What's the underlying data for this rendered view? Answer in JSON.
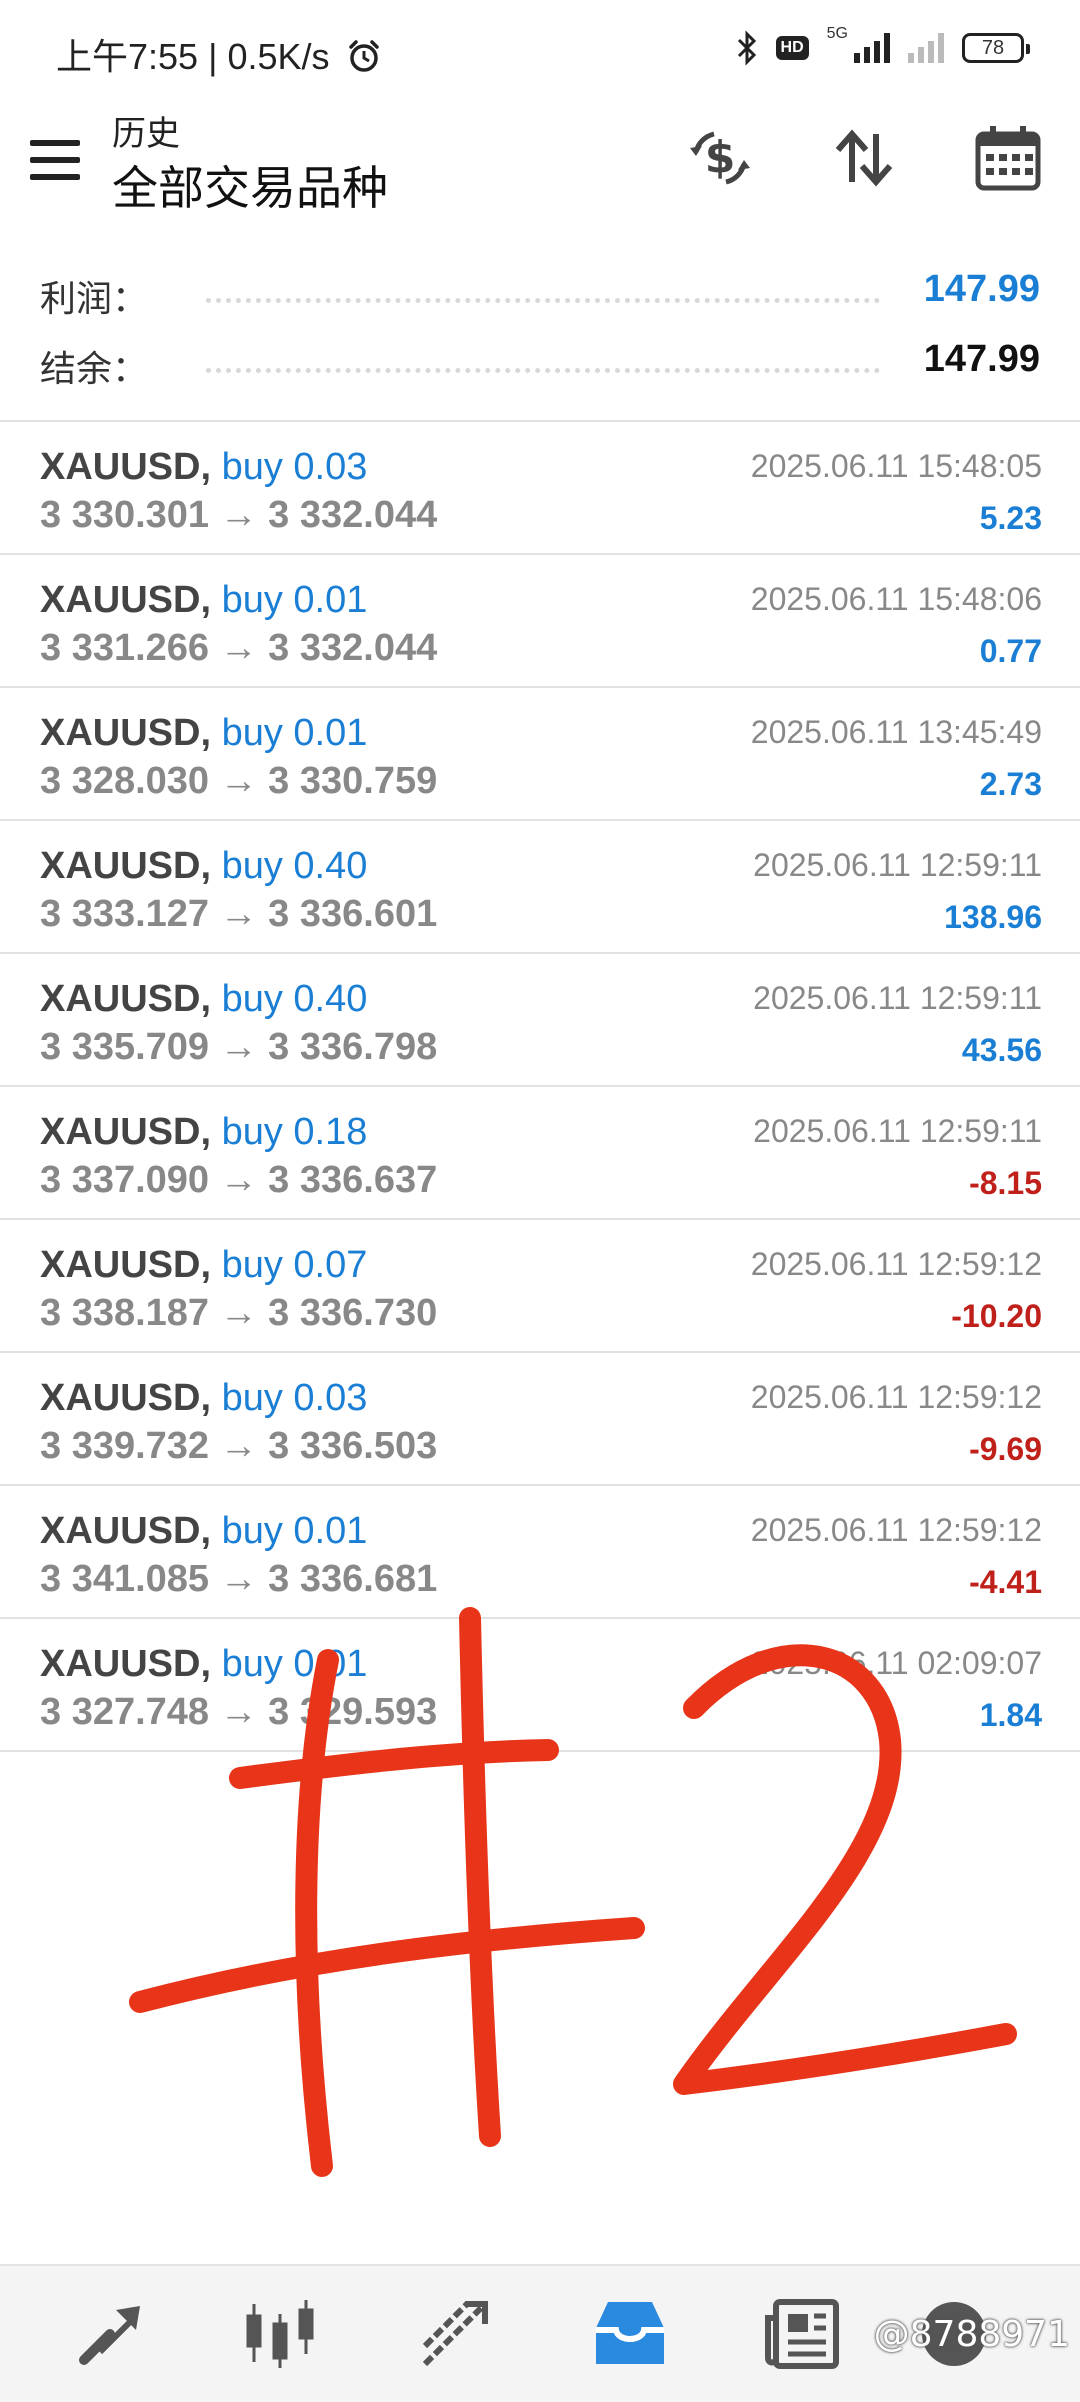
{
  "status_bar": {
    "time": "上午7:55",
    "net_speed": "0.5K/s",
    "hd": "HD",
    "network": "5G",
    "battery": "78"
  },
  "header": {
    "subtitle": "历史",
    "title": "全部交易品种"
  },
  "summary": {
    "profit_label": "利润：",
    "profit_value": "147.99",
    "balance_label": "结余：",
    "balance_value": "147.99"
  },
  "colors": {
    "positive": "#1a7fd4",
    "negative": "#c0201a",
    "overlay_mark": "#e8351a"
  },
  "trades": [
    {
      "symbol": "XAUUSD,",
      "side": "buy 0.03",
      "prices": "3 330.301 → 3 332.044",
      "time": "2025.06.11 15:48:05",
      "profit": "5.23",
      "sign": "pos"
    },
    {
      "symbol": "XAUUSD,",
      "side": "buy 0.01",
      "prices": "3 331.266 → 3 332.044",
      "time": "2025.06.11 15:48:06",
      "profit": "0.77",
      "sign": "pos"
    },
    {
      "symbol": "XAUUSD,",
      "side": "buy 0.01",
      "prices": "3 328.030 → 3 330.759",
      "time": "2025.06.11 13:45:49",
      "profit": "2.73",
      "sign": "pos"
    },
    {
      "symbol": "XAUUSD,",
      "side": "buy 0.40",
      "prices": "3 333.127 → 3 336.601",
      "time": "2025.06.11 12:59:11",
      "profit": "138.96",
      "sign": "pos"
    },
    {
      "symbol": "XAUUSD,",
      "side": "buy 0.40",
      "prices": "3 335.709 → 3 336.798",
      "time": "2025.06.11 12:59:11",
      "profit": "43.56",
      "sign": "pos"
    },
    {
      "symbol": "XAUUSD,",
      "side": "buy 0.18",
      "prices": "3 337.090 → 3 336.637",
      "time": "2025.06.11 12:59:11",
      "profit": "-8.15",
      "sign": "neg"
    },
    {
      "symbol": "XAUUSD,",
      "side": "buy 0.07",
      "prices": "3 338.187 → 3 336.730",
      "time": "2025.06.11 12:59:12",
      "profit": "-10.20",
      "sign": "neg"
    },
    {
      "symbol": "XAUUSD,",
      "side": "buy 0.03",
      "prices": "3 339.732 → 3 336.503",
      "time": "2025.06.11 12:59:12",
      "profit": "-9.69",
      "sign": "neg"
    },
    {
      "symbol": "XAUUSD,",
      "side": "buy 0.01",
      "prices": "3 341.085 → 3 336.681",
      "time": "2025.06.11 12:59:12",
      "profit": "-4.41",
      "sign": "neg"
    },
    {
      "symbol": "XAUUSD,",
      "side": "buy 0.01",
      "prices": "3 327.748 → 3 329.593",
      "time": "2025.06.11 02:09:07",
      "profit": "1.84",
      "sign": "pos"
    }
  ],
  "icons": {
    "header": [
      "currency-exchange-icon",
      "sort-icon",
      "calendar-icon"
    ],
    "nav": [
      "quotes-icon",
      "chart-icon",
      "trade-icon",
      "history-icon",
      "news-icon",
      "chat-icon"
    ]
  },
  "watermark": "@8788971"
}
